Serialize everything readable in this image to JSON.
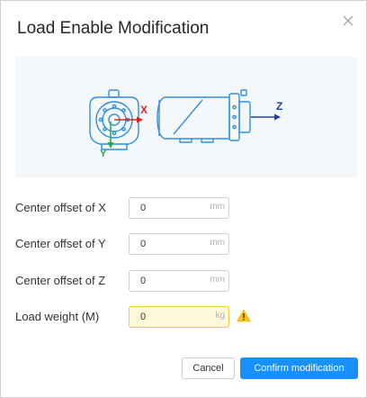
{
  "dialog": {
    "title": "Load Enable Modification"
  },
  "diagram": {
    "axis_x": "X",
    "axis_y": "Y",
    "axis_z": "Z"
  },
  "fields": [
    {
      "label": "Center offset of X",
      "value": "0",
      "unit": "mm",
      "warning": false
    },
    {
      "label": "Center offset of Y",
      "value": "0",
      "unit": "mm",
      "warning": false
    },
    {
      "label": "Center offset of Z",
      "value": "0",
      "unit": "mm",
      "warning": false
    },
    {
      "label": "Load weight (M)",
      "value": "0",
      "unit": "kg",
      "warning": true
    }
  ],
  "buttons": {
    "cancel": "Cancel",
    "confirm": "Confirm modification"
  },
  "colors": {
    "primary": "#1890ff",
    "warning": "#f2c94c",
    "robot_outline": "#2f8ee0",
    "axis_x": "#e02020",
    "axis_y": "#22aa44",
    "axis_z": "#1f3fa8"
  }
}
